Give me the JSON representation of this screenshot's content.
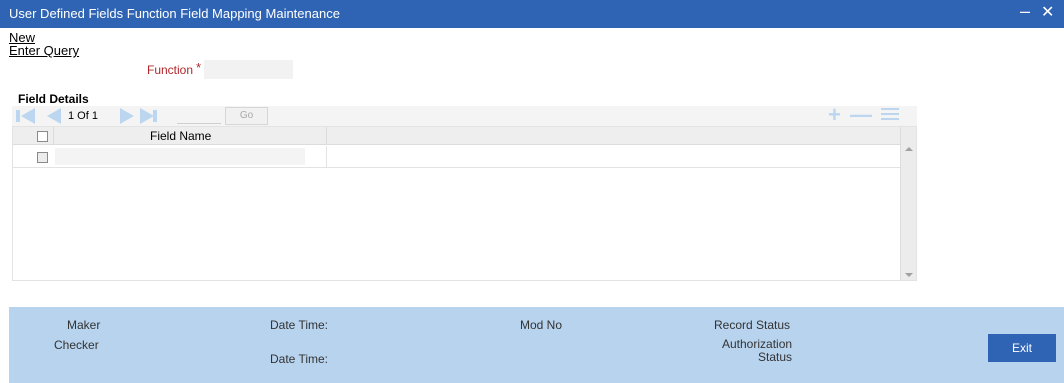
{
  "window": {
    "title": "User Defined Fields Function Field Mapping Maintenance",
    "minimize_glyph": "–",
    "close_glyph": "✕"
  },
  "menu": {
    "new_label": "New",
    "enter_query_label": "Enter Query"
  },
  "form": {
    "function_label": "Function",
    "required_mark": "*",
    "function_value": ""
  },
  "field_details": {
    "section_title": "Field Details",
    "pagination": {
      "page_text": "1 Of 1",
      "page_input_value": "",
      "go_label": "Go"
    },
    "actions": {
      "add_icon": "plus-icon",
      "delete_icon": "minus-icon",
      "view_icon": "list-icon"
    },
    "columns": [
      "Field Name"
    ],
    "rows": [
      {
        "field_name": ""
      }
    ]
  },
  "footer": {
    "maker_label": "Maker",
    "checker_label": "Checker",
    "date_time_label_1": "Date Time:",
    "date_time_label_2": "Date Time:",
    "mod_no_label": "Mod No",
    "record_status_label": "Record Status",
    "authorization_status_line1": "Authorization",
    "authorization_status_line2": "Status",
    "exit_label": "Exit"
  },
  "colors": {
    "titlebar": "#2f64b4",
    "footer": "#b7d3ee",
    "required": "#b0262b",
    "nav_icon": "#bcd6f0"
  }
}
